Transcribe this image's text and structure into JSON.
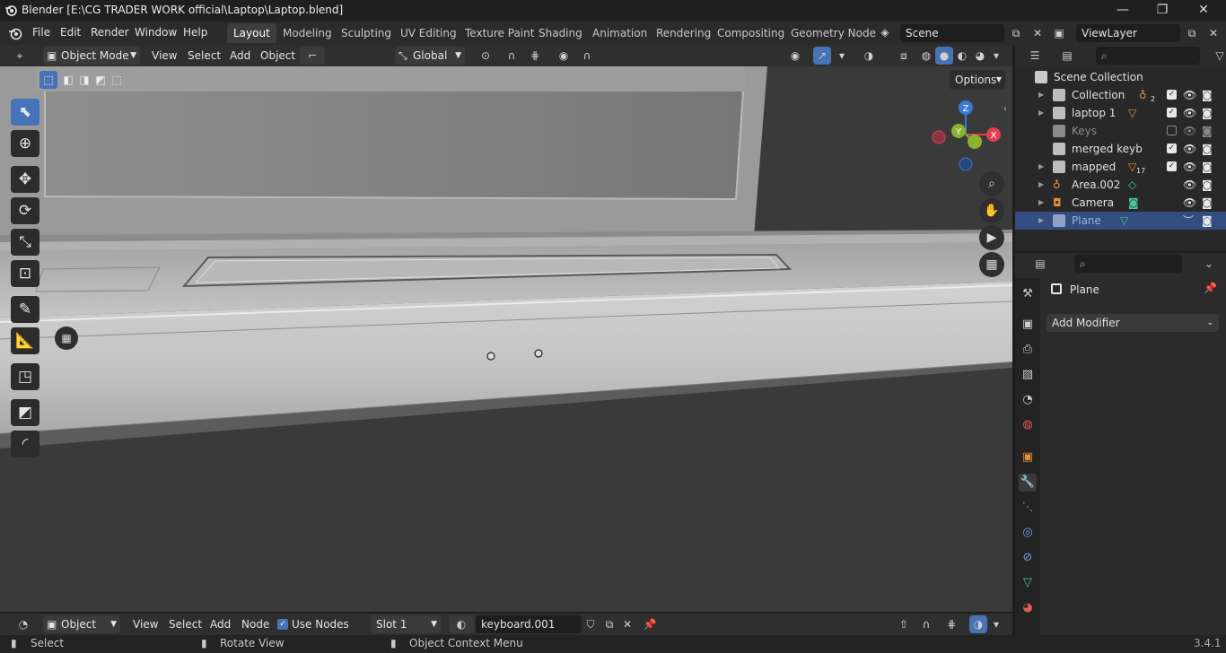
{
  "window": {
    "title": "Blender [E:\\CG TRADER WORK official\\Laptop\\Laptop.blend]",
    "minimize": "—",
    "maximize": "❐",
    "close": "✕"
  },
  "menu": [
    "File",
    "Edit",
    "Render",
    "Window",
    "Help"
  ],
  "workspaces": [
    {
      "label": "Layout",
      "active": true
    },
    {
      "label": "Modeling"
    },
    {
      "label": "Sculpting"
    },
    {
      "label": "UV Editing"
    },
    {
      "label": "Texture Paint"
    },
    {
      "label": "Shading"
    },
    {
      "label": "Animation"
    },
    {
      "label": "Rendering"
    },
    {
      "label": "Compositing"
    },
    {
      "label": "Geometry Node"
    }
  ],
  "scene": {
    "name": "Scene"
  },
  "view_layer": {
    "name": "ViewLayer"
  },
  "viewport_header": {
    "mode": "Object Mode",
    "menus": [
      "View",
      "Select",
      "Add",
      "Object"
    ],
    "transform_orientation": "Global",
    "options_label": "Options"
  },
  "gizmo": {
    "x": "X",
    "y": "Y",
    "z": "Z"
  },
  "outliner": {
    "root": "Scene Collection",
    "items": [
      {
        "name": "Collection",
        "badge": "2",
        "checked": true
      },
      {
        "name": "laptop 1",
        "checked": true
      },
      {
        "name": "Keys",
        "checked": false,
        "dim": true
      },
      {
        "name": "merged keyb",
        "checked": true
      },
      {
        "name": "mapped",
        "badge": "17",
        "checked": true
      },
      {
        "name": "Area.002"
      },
      {
        "name": "Camera"
      },
      {
        "name": "Plane",
        "selected": true
      }
    ]
  },
  "properties": {
    "object_name": "Plane",
    "add_modifier": "Add Modifier"
  },
  "node_header": {
    "type": "Object",
    "menus": [
      "View",
      "Select",
      "Add",
      "Node"
    ],
    "use_nodes": "Use Nodes",
    "slot": "Slot 1",
    "material": "keyboard.001"
  },
  "status": {
    "select": "Select",
    "rotate": "Rotate View",
    "context": "Object Context Menu",
    "version": "3.4.1"
  },
  "colors": {
    "accent": "#4772b3",
    "selected_row": "#334d80",
    "axis_x": "#e0404f",
    "axis_y": "#8bb130",
    "axis_z": "#3a7ad6"
  }
}
